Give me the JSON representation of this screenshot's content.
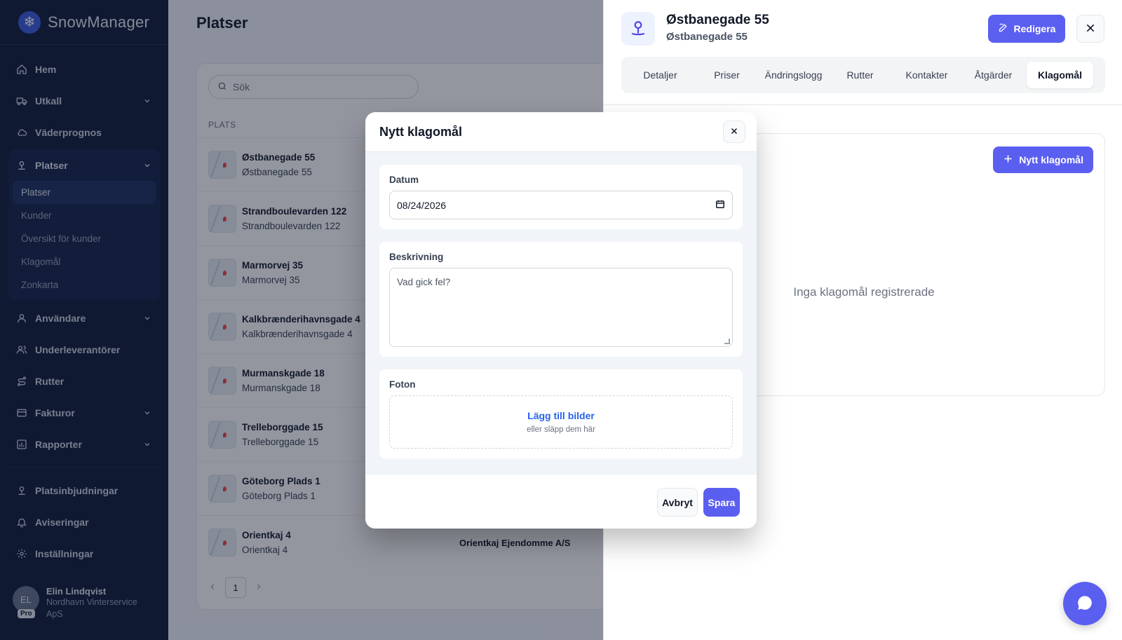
{
  "app": {
    "name": "SnowManager"
  },
  "sidebar": {
    "items": [
      {
        "label": "Hem",
        "icon": "home-icon"
      },
      {
        "label": "Utkall",
        "icon": "truck-icon",
        "expandable": true
      },
      {
        "label": "Väderprognos",
        "icon": "cloud-icon"
      },
      {
        "label": "Platser",
        "icon": "location-pin-icon",
        "expandable": true,
        "expanded": true
      },
      {
        "label": "Användare",
        "icon": "user-icon",
        "expandable": true
      },
      {
        "label": "Underleverantörer",
        "icon": "users-icon"
      },
      {
        "label": "Rutter",
        "icon": "route-icon"
      },
      {
        "label": "Fakturor",
        "icon": "invoice-icon",
        "expandable": true
      },
      {
        "label": "Rapporter",
        "icon": "chart-icon",
        "expandable": true
      }
    ],
    "sub_items": [
      "Platser",
      "Kunder",
      "Översikt för kunder",
      "Klagomål",
      "Zonkarta"
    ],
    "bottom_items": [
      {
        "label": "Platsinbjudningar",
        "icon": "location-pin-icon"
      },
      {
        "label": "Aviseringar",
        "icon": "bell-icon"
      },
      {
        "label": "Inställningar",
        "icon": "gear-icon"
      }
    ],
    "user": {
      "initials": "EL",
      "badge": "Pro",
      "name": "Elin Lindqvist",
      "company": "Nordhavn Vinterservice ApS"
    }
  },
  "main": {
    "title": "Platser",
    "search_placeholder": "Sök",
    "column_header": "PLATS",
    "rows": [
      {
        "name": "Østbanegade 55",
        "sub": "Østbanegade 55",
        "customer": ""
      },
      {
        "name": "Strandboulevarden 122",
        "sub": "Strandboulevarden 122",
        "customer": ""
      },
      {
        "name": "Marmorvej 35",
        "sub": "Marmorvej 35",
        "customer": ""
      },
      {
        "name": "Kalkbrænderihavnsgade 4",
        "sub": "Kalkbrænderihavnsgade 4",
        "customer": ""
      },
      {
        "name": "Murmanskgade 18",
        "sub": "Murmanskgade 18",
        "customer": ""
      },
      {
        "name": "Trelleborggade 15",
        "sub": "Trelleborggade 15",
        "customer": ""
      },
      {
        "name": "Göteborg Plads 1",
        "sub": "Göteborg Plads 1",
        "customer": ""
      },
      {
        "name": "Orientkaj 4",
        "sub": "Orientkaj 4",
        "customer": "Orientkaj Ejendomme A/S"
      }
    ],
    "page": "1"
  },
  "drawer": {
    "title": "Østbanegade 55",
    "subtitle": "Østbanegade 55",
    "edit_label": "Redigera",
    "tabs": [
      "Detaljer",
      "Priser",
      "Ändringslogg",
      "Rutter",
      "Kontakter",
      "Åtgärder",
      "Klagomål"
    ],
    "active_tab": "Klagomål",
    "new_button": "Nytt klagomål",
    "empty_text": "Inga klagomål registrerade"
  },
  "modal": {
    "title": "Nytt klagomål",
    "date_label": "Datum",
    "date_value": "08/24/2026",
    "description_label": "Beskrivning",
    "description_placeholder": "Vad gick fel?",
    "photos_label": "Foton",
    "add_images": "Lägg till bilder",
    "drop_hint": "eller släpp dem här",
    "cancel": "Avbryt",
    "save": "Spara"
  },
  "colors": {
    "accent": "#5b5ff0",
    "sidebar": "#0f1d3a",
    "link": "#2563eb"
  }
}
